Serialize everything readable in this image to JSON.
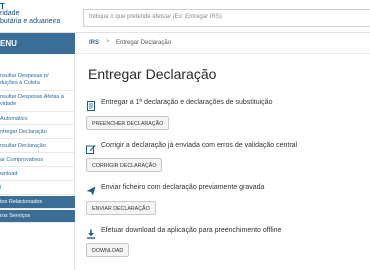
{
  "header": {
    "logo_lines": [
      "T",
      "ridade",
      "butária e aduaneira"
    ],
    "search_placeholder": "Indique o que pretende efetuar (Ex: Entregar IRS)"
  },
  "sidebar": {
    "menu_label": "ENU",
    "items": [
      {
        "lines": [
          "nsultar Despesas p/",
          "duções à Coleta"
        ]
      },
      {
        "lines": [
          "nsultar Despesas Afetas à",
          "vidade"
        ]
      },
      {
        "lines": [
          "Automático"
        ]
      },
      {
        "lines": [
          "ntregar Declaração"
        ]
      },
      {
        "lines": [
          "nsultar Declaração"
        ]
      },
      {
        "lines": [
          "ar Comprovativos"
        ]
      },
      {
        "lines": [
          "wnload"
        ]
      },
      {
        "lines": [
          "l"
        ]
      },
      {
        "lines": [
          "tos Relacionados"
        ]
      },
      {
        "lines": [
          "ros Serviços"
        ]
      }
    ]
  },
  "breadcrumb": {
    "home": "IRS",
    "separator": ">",
    "current": "Entregar Declaração"
  },
  "main": {
    "title": "Entregar Declaração",
    "sections": [
      {
        "icon": "document-icon",
        "title": "Entregar a 1ª declaração e declarações de substituição",
        "button": "PREENCHER DECLARAÇÃO"
      },
      {
        "icon": "pencil-icon",
        "title": "Corrigir a declaração já enviada com erros de validação central",
        "button": "CORRIGIR DECLARAÇÃO"
      },
      {
        "icon": "send-icon",
        "title": "Enviar ficheiro com declaração previamente gravada",
        "button": "ENVIAR DECLARAÇÃO"
      },
      {
        "icon": "download-icon",
        "title": "Efetuar download da aplicação para preenchimento offline",
        "button": "DOWNLOAD"
      }
    ]
  }
}
